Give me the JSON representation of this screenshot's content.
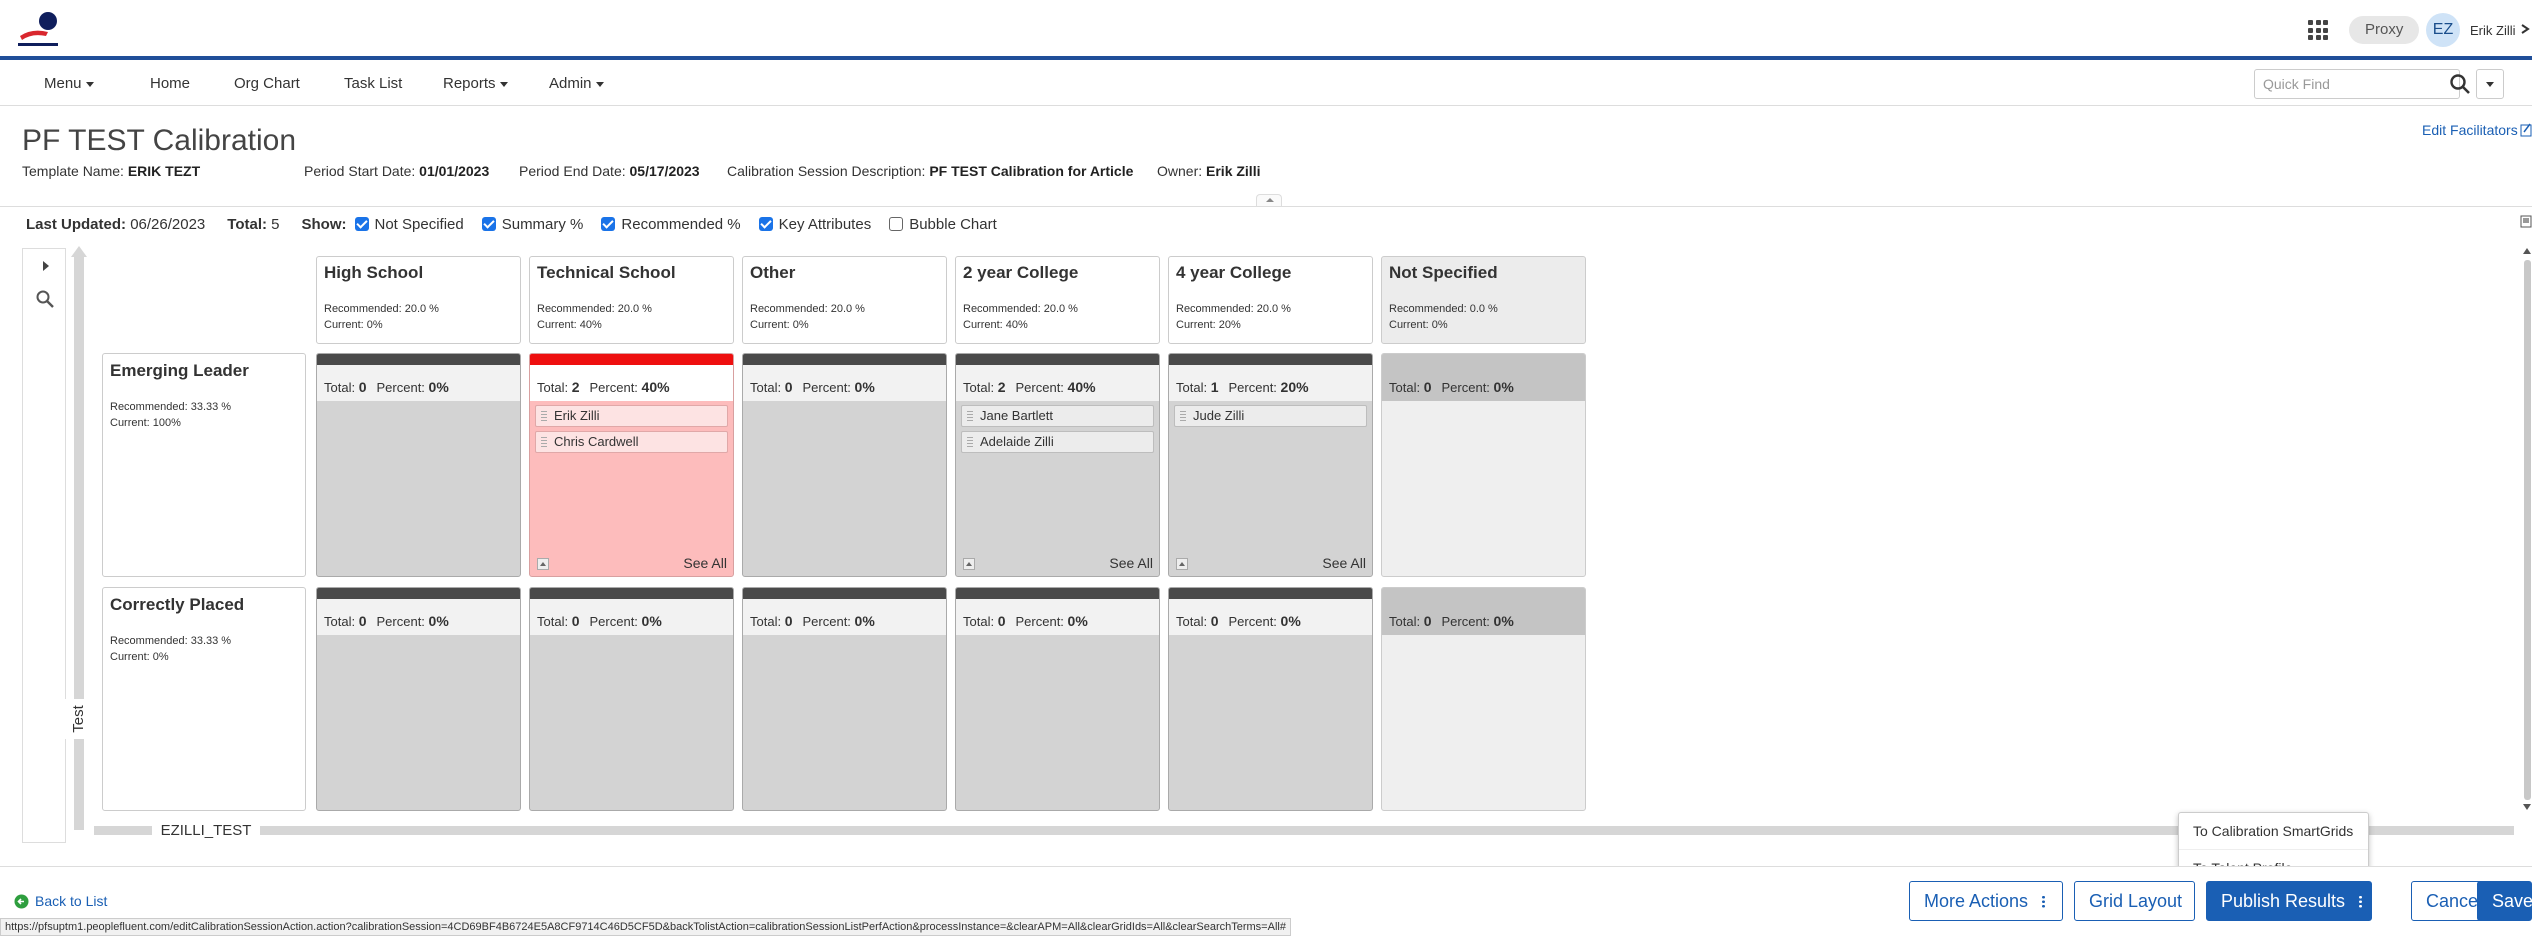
{
  "colors": {
    "brand": "#1f4e99",
    "link": "#1a5fb4",
    "over_recommended": "#ee0f0f",
    "logo_red": "#d9272e",
    "logo_navy": "#0f1e5c"
  },
  "header": {
    "proxy_label": "Proxy",
    "avatar_initials": "EZ",
    "user_name": "Erik Zilli"
  },
  "nav": {
    "items": [
      {
        "label": "Menu",
        "dropdown": true
      },
      {
        "label": "Home",
        "dropdown": false
      },
      {
        "label": "Org Chart",
        "dropdown": false
      },
      {
        "label": "Task List",
        "dropdown": false
      },
      {
        "label": "Reports",
        "dropdown": true
      },
      {
        "label": "Admin",
        "dropdown": true
      }
    ],
    "quick_find_placeholder": "Quick Find",
    "quick_find_value": ""
  },
  "page": {
    "title": "PF TEST Calibration",
    "edit_facilitators": "Edit Facilitators",
    "meta": [
      {
        "label": "Template Name:",
        "value": "ERIK TEZT"
      },
      {
        "label": "Period Start Date:",
        "value": "01/01/2023"
      },
      {
        "label": "Period End Date:",
        "value": "05/17/2023"
      },
      {
        "label": "Calibration Session Description:",
        "value": "PF TEST Calibration for Article"
      },
      {
        "label": "Owner:",
        "value": "Erik Zilli"
      }
    ]
  },
  "toolbar": {
    "last_updated_label": "Last Updated:",
    "last_updated_value": "06/26/2023",
    "total_label": "Total:",
    "total_value": "5",
    "show_label": "Show:",
    "options": [
      {
        "label": "Not Specified",
        "checked": true
      },
      {
        "label": "Summary %",
        "checked": true
      },
      {
        "label": "Recommended %",
        "checked": true
      },
      {
        "label": "Key Attributes",
        "checked": true
      },
      {
        "label": "Bubble Chart",
        "checked": false
      }
    ]
  },
  "grid": {
    "y_axis_label": "Test",
    "x_axis_label": "EZILLI_TEST",
    "total_label": "Total:",
    "percent_label": "Percent:",
    "see_all_label": "See All",
    "columns": [
      {
        "name": "High School",
        "recommended": "Recommended: 20.0 %",
        "current": "Current: 0%"
      },
      {
        "name": "Technical School",
        "recommended": "Recommended: 20.0 %",
        "current": "Current: 40%"
      },
      {
        "name": "Other",
        "recommended": "Recommended: 20.0 %",
        "current": "Current: 0%"
      },
      {
        "name": "2 year College",
        "recommended": "Recommended: 20.0 %",
        "current": "Current: 40%"
      },
      {
        "name": "4 year College",
        "recommended": "Recommended: 20.0 %",
        "current": "Current: 20%"
      },
      {
        "name": "Not Specified",
        "recommended": "Recommended: 0.0 %",
        "current": "Current: 0%"
      }
    ],
    "rows": [
      {
        "name": "Emerging Leader",
        "recommended": "Recommended: 33.33 %",
        "current": "Current: 100%",
        "cells": [
          {
            "total": "0",
            "percent": "0%",
            "employees": []
          },
          {
            "total": "2",
            "percent": "40%",
            "employees": [
              "Erik Zilli",
              "Chris Cardwell"
            ]
          },
          {
            "total": "0",
            "percent": "0%",
            "employees": []
          },
          {
            "total": "2",
            "percent": "40%",
            "employees": [
              "Jane Bartlett",
              "Adelaide Zilli"
            ]
          },
          {
            "total": "1",
            "percent": "20%",
            "employees": [
              "Jude Zilli"
            ]
          },
          {
            "total": "0",
            "percent": "0%",
            "employees": []
          }
        ]
      },
      {
        "name": "Correctly Placed",
        "recommended": "Recommended: 33.33 %",
        "current": "Current: 0%",
        "cells": [
          {
            "total": "0",
            "percent": "0%",
            "employees": []
          },
          {
            "total": "0",
            "percent": "0%",
            "employees": []
          },
          {
            "total": "0",
            "percent": "0%",
            "employees": []
          },
          {
            "total": "0",
            "percent": "0%",
            "employees": []
          },
          {
            "total": "0",
            "percent": "0%",
            "employees": []
          },
          {
            "total": "0",
            "percent": "0%",
            "employees": []
          }
        ]
      }
    ]
  },
  "footer": {
    "back_label": "Back to List",
    "buttons": {
      "more_actions": "More Actions",
      "grid_layout": "Grid Layout",
      "publish_results": "Publish Results",
      "cancel": "Cancel",
      "save": "Save"
    },
    "publish_menu": [
      "To Calibration SmartGrids",
      "To Talent Profile"
    ]
  },
  "status_url": "https://pfsuptm1.peoplefluent.com/editCalibrationSessionAction.action?calibrationSession=4CD69BF4B6724E5A8CF9714C46D5CF5D&backTolistAction=calibrationSessionListPerfAction&processInstance=&clearAPM=All&clearGridIds=All&clearSearchTerms=All#"
}
